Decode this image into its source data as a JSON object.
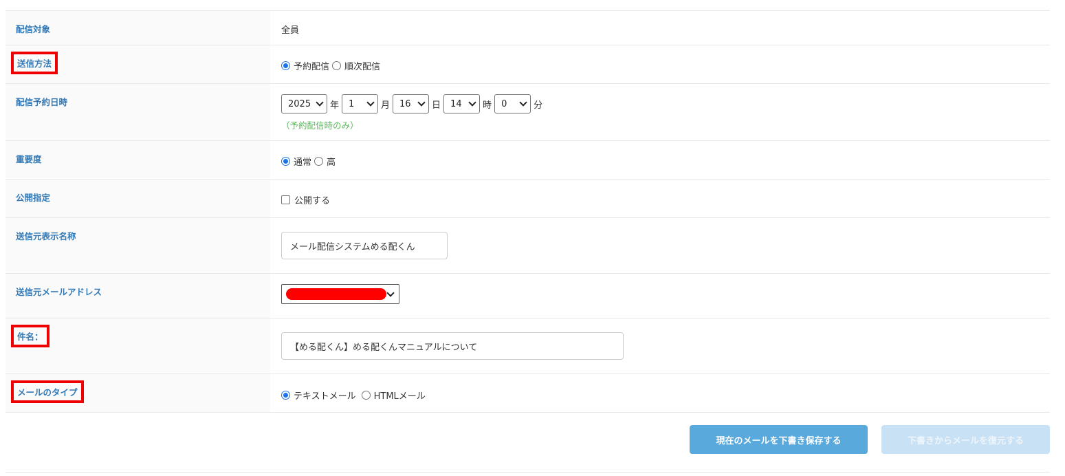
{
  "rows": {
    "target": {
      "label": "配信対象",
      "value": "全員"
    },
    "method": {
      "label": "送信方法",
      "options": [
        "予約配信",
        "順次配信"
      ],
      "selected": "予約配信"
    },
    "schedule": {
      "label": "配信予約日時",
      "year": "2025",
      "year_unit": "年",
      "month": "1",
      "month_unit": "月",
      "day": "16",
      "day_unit": "日",
      "hour": "14",
      "hour_unit": "時",
      "minute": "0",
      "minute_unit": "分",
      "note": "（予約配信時のみ）"
    },
    "importance": {
      "label": "重要度",
      "options": [
        "通常",
        "高"
      ],
      "selected": "通常"
    },
    "public": {
      "label": "公開指定",
      "checkbox_label": "公開する",
      "checked": false
    },
    "from_name": {
      "label": "送信元表示名称",
      "value": "メール配信システムめる配くん"
    },
    "from_address": {
      "label": "送信元メールアドレス",
      "value_redacted": true
    },
    "subject": {
      "label": "件名：",
      "value": "【める配くん】める配くんマニュアルについて"
    },
    "mail_type": {
      "label": "メールのタイプ",
      "options": [
        "テキストメール",
        "HTMLメール"
      ],
      "selected": "テキストメール"
    }
  },
  "buttons": {
    "save_draft": "現在のメールを下書き保存する",
    "restore_draft": "下書きからメールを復元する"
  },
  "colors": {
    "label_text": "#337ab7",
    "highlight_box": "#ee0000",
    "primary_button": "#5aa9dc",
    "disabled_button": "#c8e1f4",
    "note_text": "#5cb85c",
    "radio_selected": "#1a73e8"
  }
}
